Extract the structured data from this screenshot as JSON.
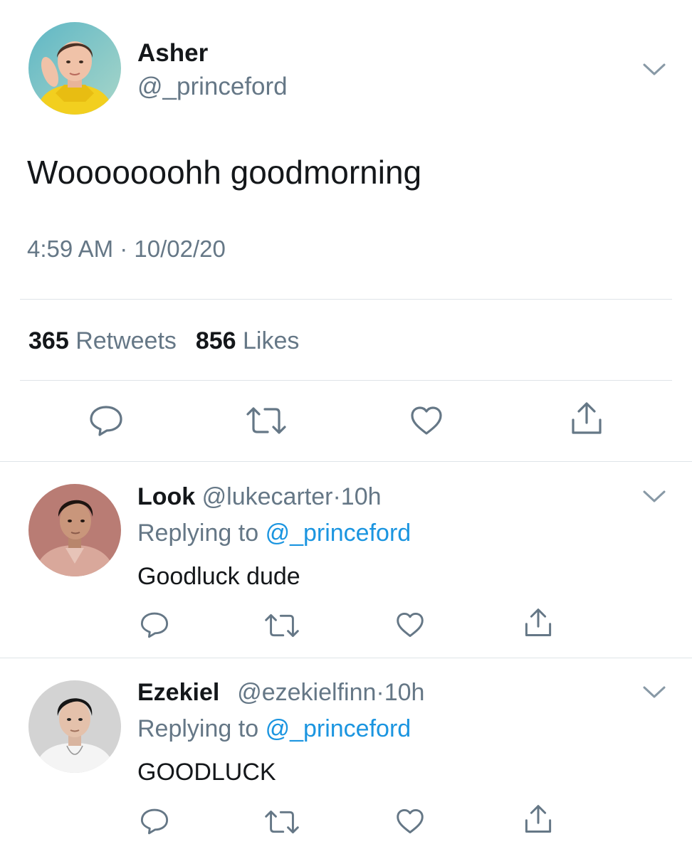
{
  "main_tweet": {
    "display_name": "Asher",
    "handle": "@_princeford",
    "text": "Wooooooohh goodmorning",
    "time": "4:59 AM",
    "separator": "·",
    "date": "10/02/20",
    "retweets_count": "365",
    "retweets_label": "Retweets",
    "likes_count": "856",
    "likes_label": "Likes",
    "avatar_icon": "person-yellow-hoodie-avatar"
  },
  "replies": [
    {
      "display_name": "Look",
      "handle": "@lukecarter",
      "separator": "·",
      "age": "10h",
      "replying_prefix": "Replying to",
      "replying_handle": "@_princeford",
      "text": "Goodluck dude",
      "avatar_icon": "person-pink-jacket-avatar"
    },
    {
      "display_name": "Ezekiel",
      "handle": "@ezekielfinn",
      "separator": "·",
      "age": "10h",
      "replying_prefix": "Replying to",
      "replying_handle": "@_princeford",
      "text": "GOODLUCK",
      "avatar_icon": "person-white-shirt-avatar"
    }
  ],
  "colors": {
    "text_primary": "#14171a",
    "text_secondary": "#657786",
    "link": "#1b95e0",
    "divider": "#dfe4e8"
  }
}
